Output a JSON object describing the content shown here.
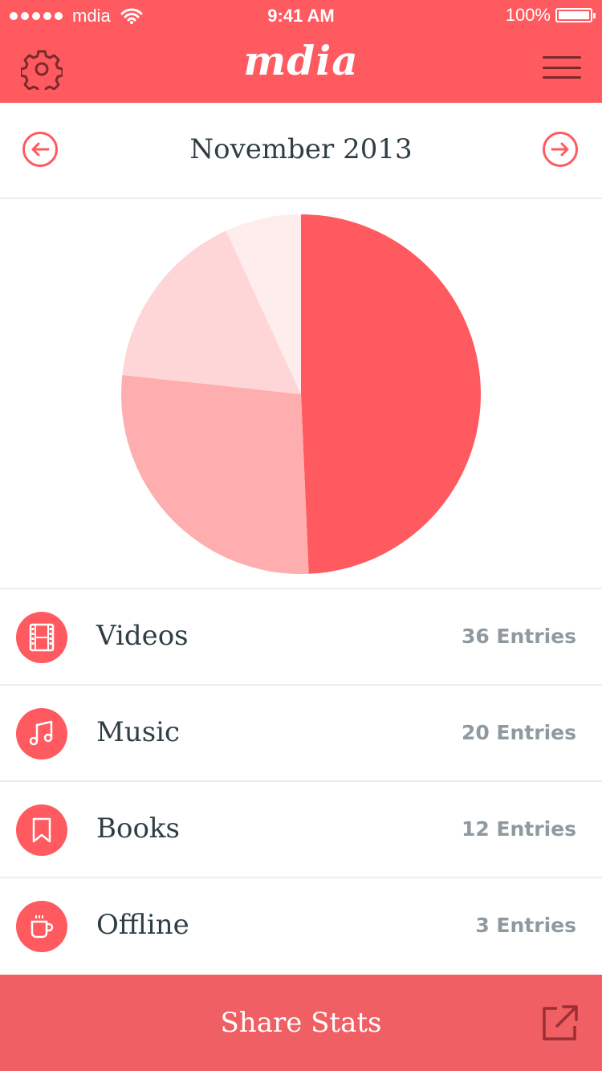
{
  "status_bar": {
    "carrier": "mdia",
    "time": "9:41 AM",
    "battery": "100%"
  },
  "nav": {
    "brand": "mdia",
    "left_icon": "gear-icon",
    "right_icon": "hamburger-menu-icon"
  },
  "month_selector": {
    "label": "November 2013",
    "prev_icon": "arrow-left-circle-icon",
    "next_icon": "arrow-right-circle-icon"
  },
  "chart_data": {
    "type": "pie",
    "categories": [
      "Videos",
      "Music",
      "Books",
      "Offline"
    ],
    "values": [
      36,
      20,
      12,
      5
    ],
    "colors": [
      "#ff5a5f",
      "#ffaeb0",
      "#ffd6d7",
      "#ffecec"
    ]
  },
  "list": {
    "items": [
      {
        "label": "Videos",
        "count": "36 Entries",
        "icon": "film-icon"
      },
      {
        "label": "Music",
        "count": "20 Entries",
        "icon": "music-note-icon"
      },
      {
        "label": "Books",
        "count": "12 Entries",
        "icon": "bookmark-icon"
      },
      {
        "label": "Offline",
        "count": "3 Entries",
        "icon": "coffee-cup-icon"
      }
    ]
  },
  "share": {
    "label": "Share Stats",
    "icon": "external-link-icon"
  },
  "colors": {
    "accent": "#ff5a5f",
    "share_bar": "#f05f63",
    "text_dark": "#2f3e44",
    "text_muted": "#8f9aa0"
  }
}
